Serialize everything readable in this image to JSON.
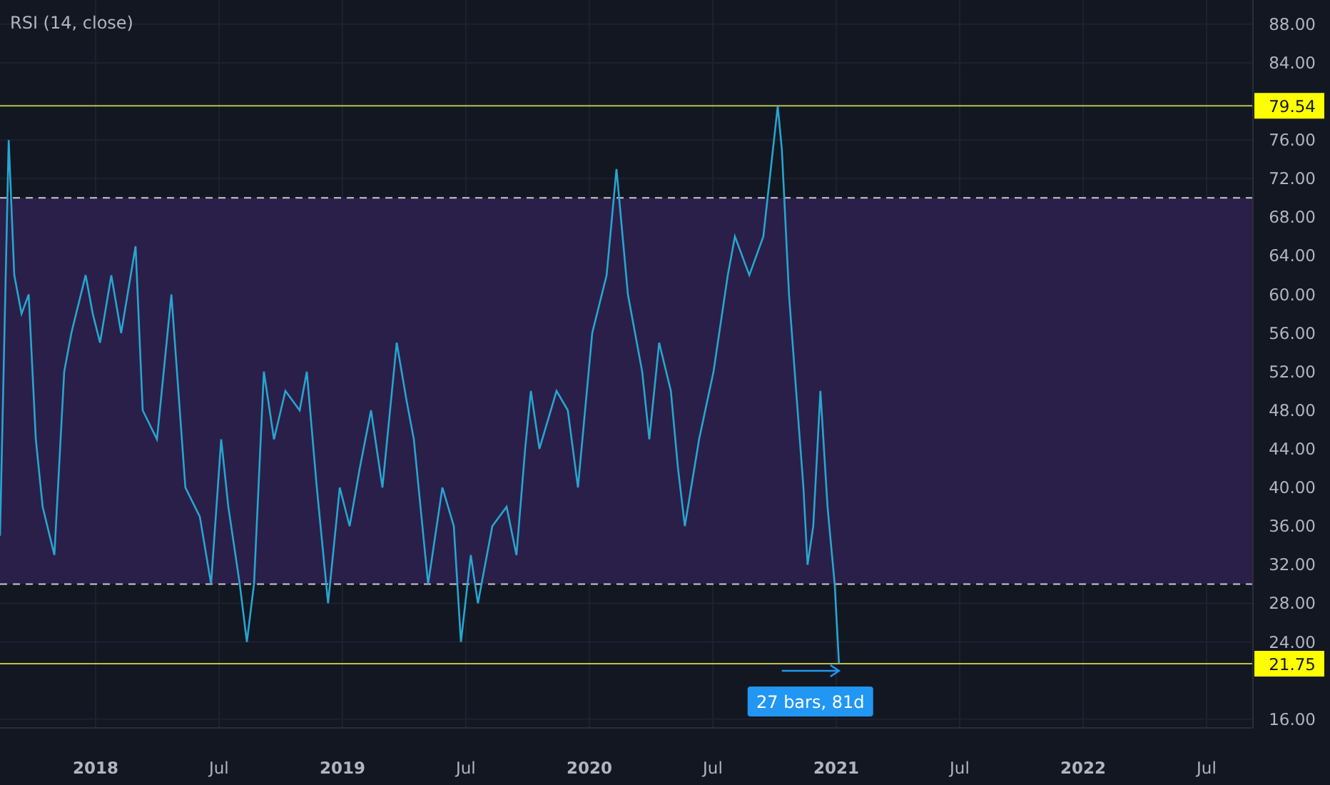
{
  "chart_data": {
    "type": "line",
    "title": "RSI (14, close)",
    "x": [
      2017.613,
      2017.648,
      2017.671,
      2017.7,
      2017.729,
      2017.758,
      2017.786,
      2017.833,
      2017.873,
      2017.902,
      2017.96,
      2017.989,
      2018.018,
      2018.064,
      2018.104,
      2018.162,
      2018.191,
      2018.249,
      2018.307,
      2018.364,
      2018.422,
      2018.468,
      2018.509,
      2018.538,
      2018.584,
      2018.613,
      2018.642,
      2018.682,
      2018.723,
      2018.769,
      2018.827,
      2018.856,
      2018.896,
      2018.942,
      2018.989,
      2019.029,
      2019.07,
      2019.116,
      2019.162,
      2019.22,
      2019.26,
      2019.289,
      2019.347,
      2019.405,
      2019.451,
      2019.48,
      2019.52,
      2019.549,
      2019.607,
      2019.665,
      2019.705,
      2019.74,
      2019.763,
      2019.798,
      2019.867,
      2019.913,
      2019.954,
      2020.012,
      2020.07,
      2020.11,
      2020.156,
      2020.214,
      2020.243,
      2020.283,
      2020.33,
      2020.359,
      2020.387,
      2020.445,
      2020.503,
      2020.561,
      2020.59,
      2020.648,
      2020.705,
      2020.763,
      2020.78,
      2020.809,
      2020.838,
      2020.867,
      2020.884,
      2020.907,
      2020.936,
      2020.965,
      2020.994,
      2021.011
    ],
    "series": [
      {
        "color": "#26a6d1",
        "values": [
          35,
          76,
          62,
          58,
          60,
          45,
          38,
          33,
          52,
          56,
          62,
          58,
          55,
          62,
          56,
          65,
          48,
          45,
          60,
          40,
          37,
          30,
          45,
          38,
          30,
          24,
          30,
          52,
          45,
          50,
          48,
          52,
          40,
          28,
          40,
          36,
          42,
          48,
          40,
          55,
          49,
          45,
          30,
          40,
          36,
          24,
          33,
          28,
          36,
          38,
          33,
          44,
          50,
          44,
          50,
          48,
          40,
          56,
          62,
          73,
          60,
          52,
          45,
          55,
          50,
          42,
          36,
          45,
          52,
          62,
          66,
          62,
          66,
          79.5,
          75,
          60,
          50,
          40,
          32,
          36,
          50,
          38,
          30,
          21.8
        ]
      }
    ],
    "xlim": [
      2017.613,
      2022.688
    ],
    "ylim": [
      15.1,
      90.5
    ],
    "xticks": [
      {
        "value": 2018,
        "label": "2018"
      },
      {
        "value": 2018.5,
        "label": "Jul"
      },
      {
        "value": 2019,
        "label": "2019"
      },
      {
        "value": 2019.5,
        "label": "Jul"
      },
      {
        "value": 2020,
        "label": "2020"
      },
      {
        "value": 2020.5,
        "label": "Jul"
      },
      {
        "value": 2021,
        "label": "2021"
      },
      {
        "value": 2021.5,
        "label": "Jul"
      },
      {
        "value": 2022,
        "label": "2022"
      },
      {
        "value": 2022.5,
        "label": "Jul"
      }
    ],
    "yticks": [
      {
        "value": 16,
        "label": "16.00"
      },
      {
        "value": 24,
        "label": "24.00"
      },
      {
        "value": 28,
        "label": "28.00"
      },
      {
        "value": 32,
        "label": "32.00"
      },
      {
        "value": 36,
        "label": "36.00"
      },
      {
        "value": 40,
        "label": "40.00"
      },
      {
        "value": 44,
        "label": "44.00"
      },
      {
        "value": 48,
        "label": "48.00"
      },
      {
        "value": 52,
        "label": "52.00"
      },
      {
        "value": 56,
        "label": "56.00"
      },
      {
        "value": 60,
        "label": "60.00"
      },
      {
        "value": 64,
        "label": "64.00"
      },
      {
        "value": 68,
        "label": "68.00"
      },
      {
        "value": 72,
        "label": "72.00"
      },
      {
        "value": 76,
        "label": "76.00"
      },
      {
        "value": 84,
        "label": "84.00"
      },
      {
        "value": 88,
        "label": "88.00"
      }
    ],
    "grid": true,
    "bands": [
      {
        "axis": "y",
        "from": 30,
        "to": 70,
        "color": "#2a1f48"
      }
    ],
    "ref_lines": [
      {
        "axis": "y",
        "value": 79.54,
        "label": "79.54",
        "color": "#b8c24a"
      },
      {
        "axis": "y",
        "value": 70,
        "color": "#c8cad0"
      },
      {
        "axis": "y",
        "value": 30,
        "color": "#c8cad0"
      },
      {
        "axis": "y",
        "value": 21.75,
        "label": "21.75",
        "color": "#b8c24a"
      }
    ],
    "annotations": [
      "27 bars, 81d"
    ]
  }
}
